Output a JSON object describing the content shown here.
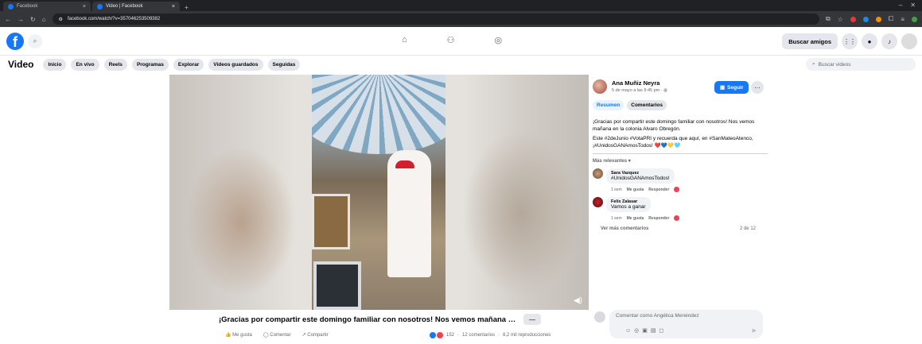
{
  "browser": {
    "tabs": [
      {
        "label": "Facebook"
      },
      {
        "label": "Video | Facebook"
      }
    ],
    "url": "facebook.com/watch/?v=357046253509382"
  },
  "fb": {
    "find_friends": "Buscar amigos"
  },
  "subnav": {
    "title": "Video",
    "items": [
      "Inicio",
      "En vivo",
      "Reels",
      "Programas",
      "Explorar",
      "Videos guardados",
      "Seguidas"
    ],
    "search_placeholder": "Buscar videos"
  },
  "video": {
    "caption": "¡Gracias por compartir este domingo familiar con nosotros! Nos vemos mañana en l...",
    "more": "—",
    "like": "Me gusta",
    "comment": "Comentar",
    "share": "Compartir",
    "reactions": "152",
    "comments_count": "12 comentarios",
    "views": "8,2 mil reproducciones"
  },
  "sidebar": {
    "author": "Ana Muñiz Neyra",
    "time": "5 de mayo a las 9:45 pm · ",
    "follow": "Seguir",
    "tab_summary": "Resumen",
    "tab_comments": "Comentarios",
    "post_p1": "¡Gracias por compartir este domingo familiar con nosotros! Nos vemos mañana en la colonia Alvaro Obregón.",
    "post_p2": "Este #2deJunio #VotaPRI y recuerda que aquí, en #SanMateoAtenco, ¡#UnidosGANAmosTodos! ❤️💙💛🩵",
    "relevant": "Más relevantes ▾",
    "comments": [
      {
        "name": "Sara Vazquez",
        "text": "#UnidosGANAmosTodos!",
        "time": "1 sem",
        "like": "Me gusta",
        "reply": "Responder"
      },
      {
        "name": "Felix Zalasar",
        "text": "Vamos a ganar",
        "time": "1 sem",
        "like": "Me gusta",
        "reply": "Responder"
      }
    ],
    "view_more": "Ver más comentarios",
    "pager": "2 de 12",
    "composer_placeholder": "Comentar como Angélica Menéndez"
  }
}
